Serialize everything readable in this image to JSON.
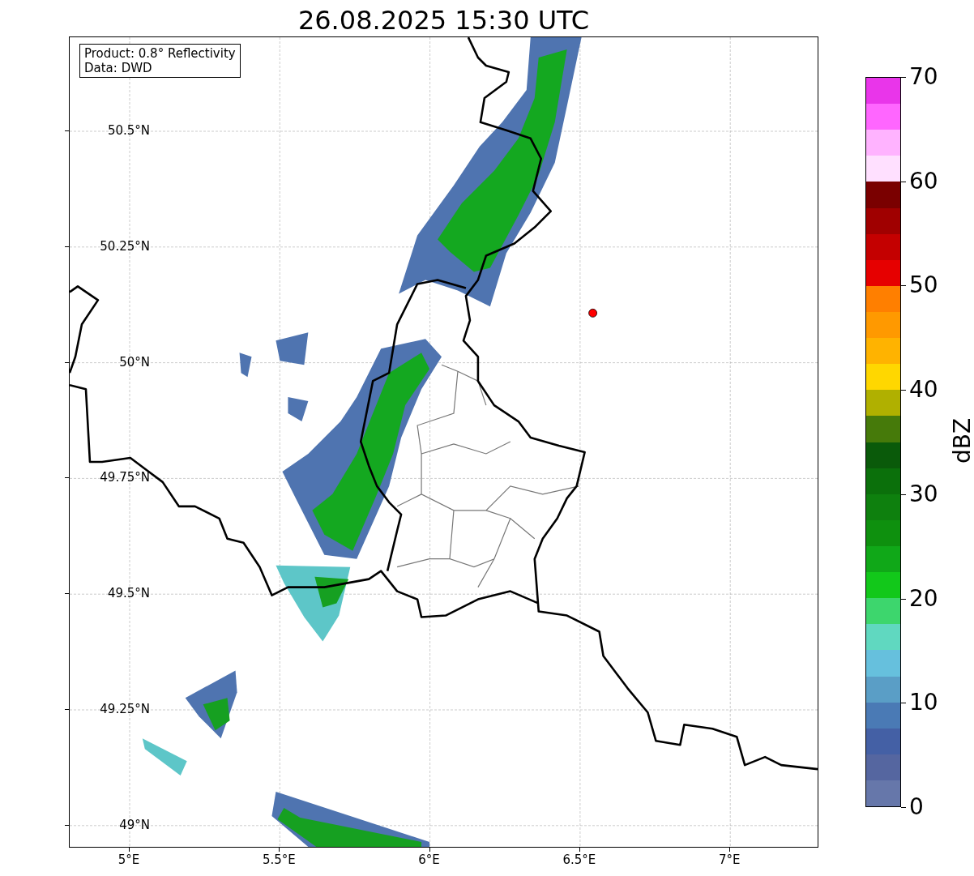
{
  "title": "26.08.2025 15:30 UTC",
  "info_box": [
    "Product: 0.8° Reflectivity",
    "Data: DWD"
  ],
  "y_ticks": [
    "50.5°N",
    "50.25°N",
    "50°N",
    "49.75°N",
    "49.5°N",
    "49.25°N",
    "49°N"
  ],
  "x_ticks": [
    "5°E",
    "5.5°E",
    "6°E",
    "6.5°E",
    "7°E"
  ],
  "colorbar": {
    "label": "dBZ",
    "ticks": [
      "70",
      "60",
      "50",
      "40",
      "30",
      "20",
      "10",
      "0"
    ],
    "segments": [
      {
        "color": "#e935ea"
      },
      {
        "color": "#ff66ff"
      },
      {
        "color": "#ffb3ff"
      },
      {
        "color": "#ffe0ff"
      },
      {
        "color": "#7a0000"
      },
      {
        "color": "#a00000"
      },
      {
        "color": "#c40000"
      },
      {
        "color": "#e60000"
      },
      {
        "color": "#ff7f00"
      },
      {
        "color": "#ff9900"
      },
      {
        "color": "#ffb300"
      },
      {
        "color": "#ffd700"
      },
      {
        "color": "#b0b000"
      },
      {
        "color": "#467a0a"
      },
      {
        "color": "#0a5a0a"
      },
      {
        "color": "#0b700b"
      },
      {
        "color": "#0e800e"
      },
      {
        "color": "#0e900e"
      },
      {
        "color": "#10a818"
      },
      {
        "color": "#12c81a"
      },
      {
        "color": "#3dd66d"
      },
      {
        "color": "#60d8c0"
      },
      {
        "color": "#66c0dd"
      },
      {
        "color": "#5a9ec6"
      },
      {
        "color": "#4a7ab5"
      },
      {
        "color": "#4460a5"
      },
      {
        "color": "#5566a0"
      },
      {
        "color": "#6677aa"
      }
    ]
  }
}
